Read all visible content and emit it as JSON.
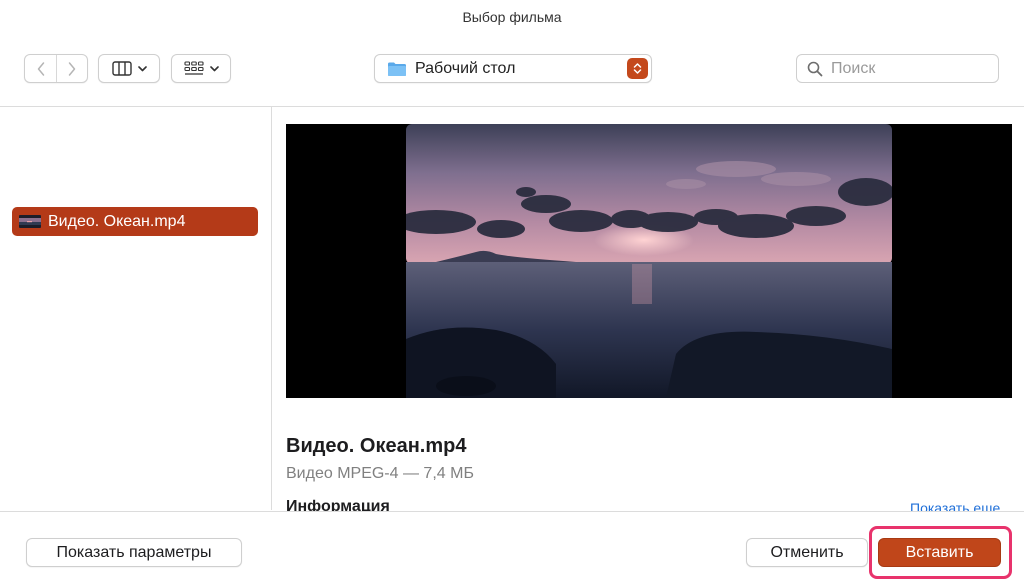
{
  "dialog": {
    "title": "Выбор фильма"
  },
  "toolbar": {
    "back_icon": "chevron-left-icon",
    "forward_icon": "chevron-right-icon",
    "column_view_icon": "columns-icon",
    "grid_view_icon": "grid-icon",
    "location_label": "Рабочий стол",
    "location_icon": "folder-icon",
    "search_placeholder": "Поиск"
  },
  "file_list": {
    "items": [
      {
        "name": "Видео. Океан.mp4",
        "selected": true
      }
    ]
  },
  "preview": {
    "file_name": "Видео. Океан.mp4",
    "file_meta": "Видео MPEG-4 — 7,4 МБ",
    "info_heading": "Информация",
    "show_more": "Показать еще"
  },
  "footer": {
    "options_label": "Показать параметры",
    "cancel_label": "Отменить",
    "insert_label": "Вставить"
  },
  "colors": {
    "accent": "#c0461a",
    "selection": "#b43a18",
    "highlight": "#e8336c",
    "link": "#1f6fd8"
  }
}
